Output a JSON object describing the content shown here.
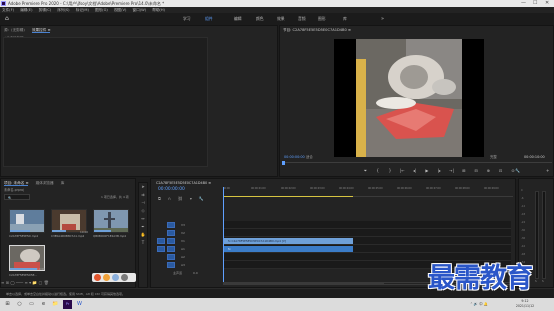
{
  "window": {
    "title": "Adobe Premiere Pro 2020 - C:\\用户\\jfsoy\\文档\\Adobe\\Premiere Pro\\14.0\\未命名 *",
    "controls": [
      "—",
      "☐",
      "✕"
    ]
  },
  "menu": [
    "文件(F)",
    "编辑(E)",
    "剪辑(C)",
    "序列(S)",
    "标记(M)",
    "图形(G)",
    "视图(V)",
    "窗口(W)",
    "帮助(H)"
  ],
  "workspaces": {
    "items": [
      "学习",
      "组件",
      "编辑",
      "颜色",
      "效果",
      "音频",
      "图形",
      "库"
    ],
    "active_index": 1,
    "more": "»"
  },
  "source_panel": {
    "tabs": [
      "源：(无剪辑)",
      "效果控件 ≡"
    ],
    "active_tab": 1,
    "label": "(未选择剪辑)"
  },
  "program_monitor": {
    "title": "节目: C2A78F5E5E5D5E0C7A1D4B0 ≡",
    "timecode": "00:00:00:00",
    "fit": "适合",
    "resolution": "完整",
    "duration": "00:00:10:00",
    "transport": [
      "⏷",
      "{",
      "}",
      "|←",
      "◂|",
      "▶",
      "|▸",
      "→|",
      "⊞",
      "⊟",
      "⊕",
      "⊡",
      "⊙"
    ],
    "settings": "🔧",
    "add": "+"
  },
  "project_panel": {
    "tabs": [
      "项目: 未命名 ≡",
      "媒体浏览器",
      "库"
    ],
    "active_tab": 0,
    "path": "未命名.prproj",
    "search_placeholder": "🔍",
    "count": "1 项已选择，共 4 项",
    "items": [
      {
        "name": "C2A78F5E5E5D.mp4",
        "dur": "",
        "bar": 0.6
      },
      {
        "name": "C3E0A4D0B8C7A1.mp4",
        "dur": "10:00",
        "bar": 0.4
      },
      {
        "name": "QB0B0C0F1E2A3B.mp4",
        "dur": "",
        "bar": 0.5
      },
      {
        "name": "C2A78F5E5E5D5E...",
        "dur": "10:00",
        "bar": 0.8
      }
    ],
    "footer_icons": "≡ ⊞ ◯ ─── ≡ ▾ 📁 ▢ 🗑"
  },
  "timeline": {
    "title": "C2A78F5E5E5D5E0C7A1D4B0 ≡",
    "timecode": "00:00:00:00",
    "ruler": [
      "00:00",
      "00:00:01:00",
      "00:00:02:00",
      "00:00:03:00",
      "00:00:04:00",
      "00:00:05:00",
      "00:00:06:00",
      "00:00:07:00",
      "00:00:08:00",
      "00:00:09:00"
    ],
    "tracks": [
      "V3",
      "V2",
      "V1",
      "A1",
      "A2",
      "A3",
      "主声道"
    ],
    "master_value": "0.0",
    "video_clip": "fx C2A78F5E5E5D5E0C7A1D4B0.mp4 [V]",
    "audio_clip": "fx"
  },
  "meters": {
    "scale": [
      "0",
      "-6",
      "-12",
      "-18",
      "-24",
      "-30",
      "-36",
      "-42",
      "-48",
      "-54",
      "dB"
    ],
    "labels": [
      "S",
      "S"
    ]
  },
  "status_bar": "单击以选择，或单击空白处并拖动以进行框选。使用 Shift、Alt 和 Ctrl 可获得其他选项。",
  "taskbar": {
    "time": "9:12",
    "date": "2021/11/12",
    "sys": "⌃ 🔊 中 🔔"
  },
  "watermark": "最需教育"
}
